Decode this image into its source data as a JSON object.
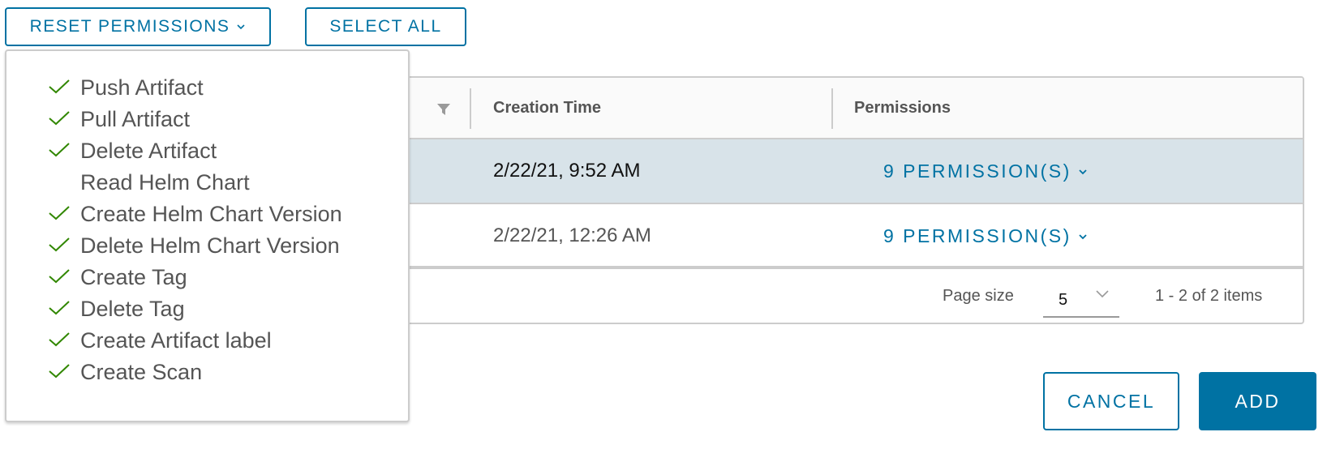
{
  "toolbar": {
    "reset_label": "RESET PERMISSIONS",
    "select_all_label": "SELECT ALL"
  },
  "menu": {
    "items": [
      {
        "label": "Push Artifact",
        "checked": true
      },
      {
        "label": "Pull Artifact",
        "checked": true
      },
      {
        "label": "Delete Artifact",
        "checked": true
      },
      {
        "label": "Read Helm Chart",
        "checked": false
      },
      {
        "label": "Create Helm Chart Version",
        "checked": true
      },
      {
        "label": "Delete Helm Chart Version",
        "checked": true
      },
      {
        "label": "Create Tag",
        "checked": true
      },
      {
        "label": "Delete Tag",
        "checked": true
      },
      {
        "label": "Create Artifact label",
        "checked": true
      },
      {
        "label": "Create Scan",
        "checked": true
      }
    ]
  },
  "grid": {
    "columns": {
      "creation_time": "Creation Time",
      "permissions": "Permissions"
    },
    "rows": [
      {
        "creation_time": "2/22/21, 9:52 AM",
        "permissions": "9 PERMISSION(S)",
        "selected": true
      },
      {
        "creation_time": "2/22/21, 12:26 AM",
        "permissions": "9 PERMISSION(S)",
        "selected": false
      }
    ],
    "footer": {
      "page_size_label": "Page size",
      "page_size_value": "5",
      "count_text": "1 - 2 of 2 items"
    }
  },
  "dialog": {
    "cancel_label": "CANCEL",
    "add_label": "ADD"
  },
  "colors": {
    "accent": "#0072a3",
    "check": "#318700",
    "selected_row": "#d8e3e9"
  }
}
